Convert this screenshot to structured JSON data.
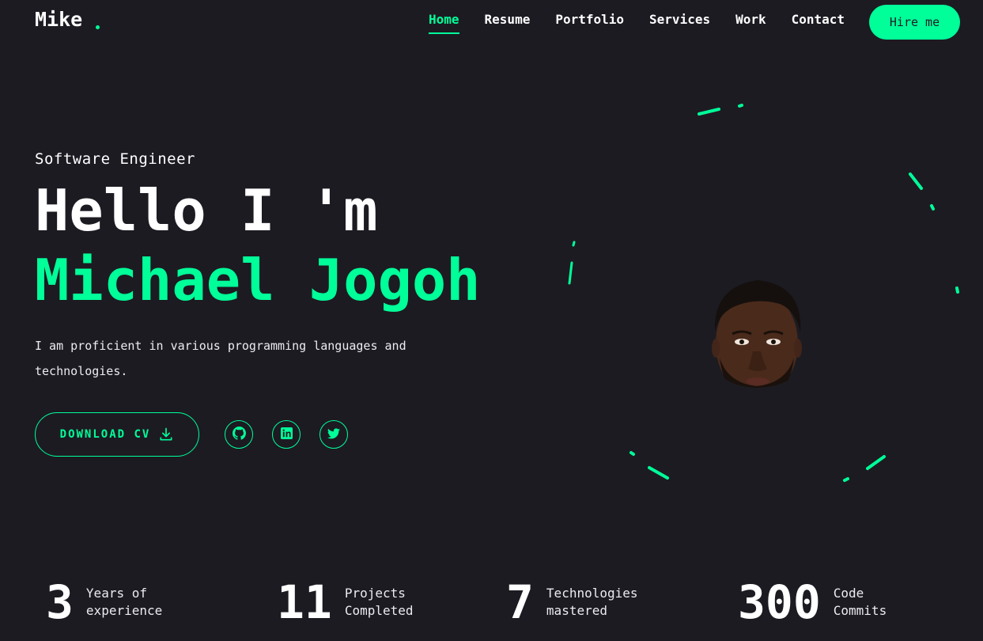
{
  "logo": {
    "text": "Mike",
    "dot": "."
  },
  "nav": {
    "items": [
      {
        "label": "Home",
        "active": true
      },
      {
        "label": "Resume",
        "active": false
      },
      {
        "label": "Portfolio",
        "active": false
      },
      {
        "label": "Services",
        "active": false
      },
      {
        "label": "Work",
        "active": false
      },
      {
        "label": "Contact",
        "active": false
      }
    ],
    "hire_label": "Hire me"
  },
  "hero": {
    "role": "Software Engineer",
    "greeting": "Hello I 'm",
    "name": "Michael Jogoh",
    "bio": "I am proficient in various programming languages and technologies.",
    "cv_label": "DOWNLOAD CV",
    "socials": [
      {
        "icon": "github-icon"
      },
      {
        "icon": "linkedin-icon"
      },
      {
        "icon": "twitter-icon"
      }
    ]
  },
  "stats": [
    {
      "value": "3",
      "label_line1": "Years of",
      "label_line2": "experience"
    },
    {
      "value": "11",
      "label_line1": "Projects",
      "label_line2": "Completed"
    },
    {
      "value": "7",
      "label_line1": "Technologies",
      "label_line2": "mastered"
    },
    {
      "value": "300",
      "label_line1": "Code",
      "label_line2": "Commits"
    }
  ],
  "colors": {
    "background": "#1c1b22",
    "accent": "#00ff99",
    "text": "#ffffff"
  }
}
